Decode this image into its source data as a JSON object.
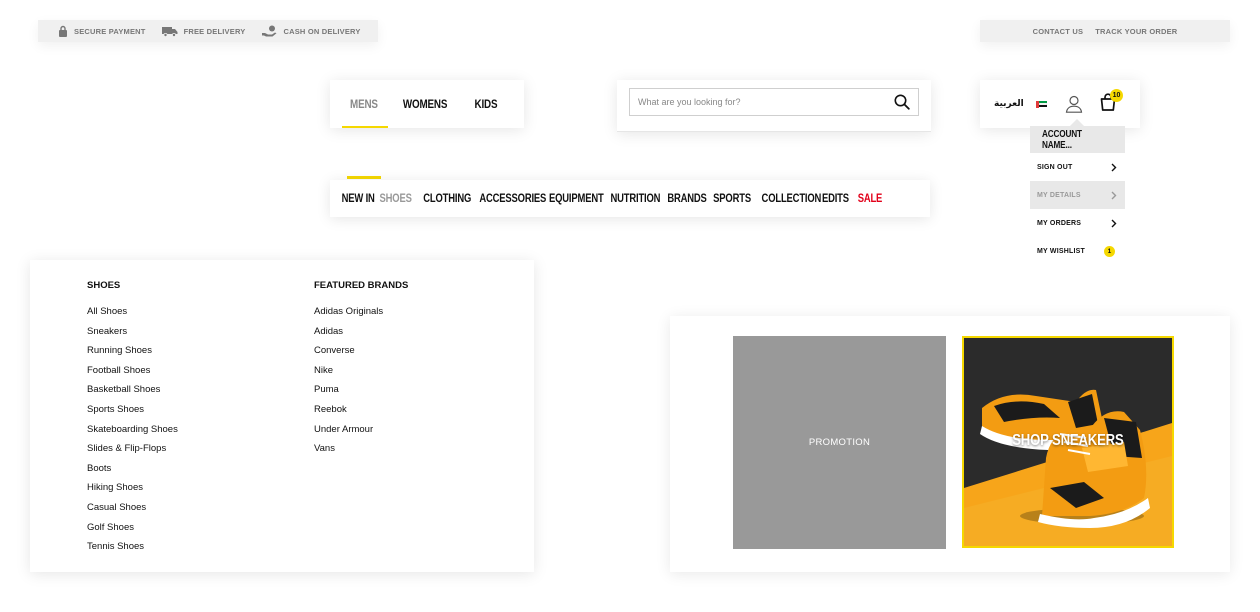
{
  "topbar": {
    "secure_payment": "SECURE PAYMENT",
    "free_delivery": "FREE DELIVERY",
    "cash_on_delivery": "CASH ON DELIVERY",
    "contact_us": "CONTACT US",
    "track_order": "TRACK YOUR ORDER"
  },
  "gender_tabs": [
    "MENS",
    "WOMENS",
    "KIDS"
  ],
  "search": {
    "placeholder": "What are you looking for?"
  },
  "account": {
    "language": "العربية",
    "cart_count": "10",
    "dropdown": {
      "header": "ACCOUNT NAME...",
      "items": [
        "SIGN OUT",
        "MY DETAILS",
        "MY ORDERS",
        "MY WISHLIST"
      ],
      "wishlist_count": "1"
    }
  },
  "categories": [
    "NEW IN",
    "SHOES",
    "CLOTHING",
    "ACCESSORIES",
    "EQUIPMENT",
    "NUTRITION",
    "BRANDS",
    "SPORTS",
    "COLLECTION",
    "EDITS",
    "SALE"
  ],
  "mega_menu": {
    "shoes": {
      "heading": "SHOES",
      "items": [
        "All Shoes",
        "Sneakers",
        "Running Shoes",
        "Football Shoes",
        "Basketball Shoes",
        "Sports Shoes",
        "Skateboarding Shoes",
        "Slides & Flip-Flops",
        "Boots",
        "Hiking Shoes",
        "Casual Shoes",
        "Golf Shoes",
        "Tennis Shoes"
      ]
    },
    "brands": {
      "heading": "FEATURED BRANDS",
      "items": [
        "Adidas Originals",
        "Adidas",
        "Converse",
        "Nike",
        "Puma",
        "Reebok",
        "Under Armour",
        "Vans"
      ]
    }
  },
  "promo": {
    "promotion_label": "PROMOTION",
    "sneakers_label": "SHOP SNEAKERS"
  },
  "colors": {
    "accent_yellow": "#f5d800",
    "sale_red": "#e2001a",
    "muted_grey": "#999999",
    "promo_grey": "#999999"
  }
}
